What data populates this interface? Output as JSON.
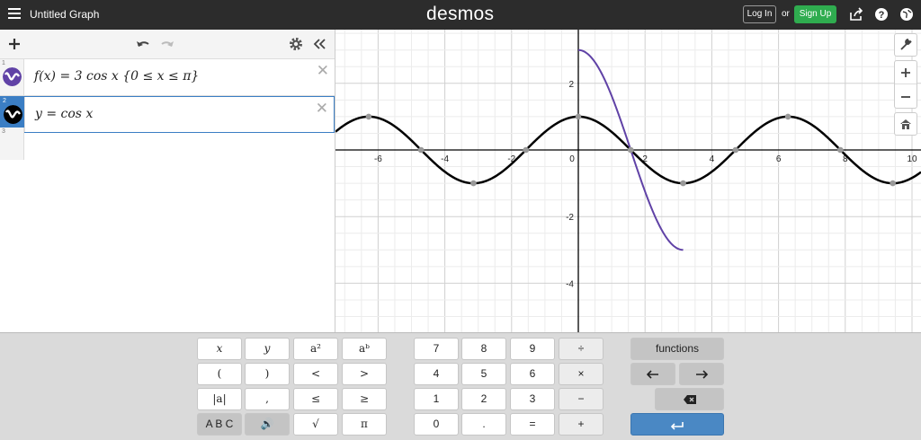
{
  "header": {
    "title": "Untitled Graph",
    "logo": "desmos",
    "login_label": "Log In",
    "or_label": "or",
    "signup_label": "Sign Up"
  },
  "sidebar": {
    "expressions": [
      {
        "number": "1",
        "latex": "f(x) = 3 cos x {0 ≤ x ≤ π}",
        "color": "#6042a6"
      },
      {
        "number": "2",
        "latex": "y = cos x",
        "color": "#000000"
      },
      {
        "number": "3",
        "latex": ""
      }
    ]
  },
  "graph": {
    "x_ticks": [
      "-6",
      "-4",
      "-2",
      "0",
      "2",
      "4",
      "6",
      "8",
      "10"
    ],
    "y_ticks": [
      "2",
      "-2",
      "-4"
    ]
  },
  "keypad": {
    "left": [
      [
        "x",
        "y",
        "a²",
        "aᵇ"
      ],
      [
        "(",
        ")",
        "<",
        ">"
      ],
      [
        "|a|",
        ",",
        "≤",
        "≥"
      ],
      [
        "A B C",
        "🔊",
        "√",
        "π"
      ]
    ],
    "middle": [
      [
        "7",
        "8",
        "9",
        "÷"
      ],
      [
        "4",
        "5",
        "6",
        "×"
      ],
      [
        "1",
        "2",
        "3",
        "−"
      ],
      [
        "0",
        ".",
        "=",
        "+"
      ]
    ],
    "functions_label": "functions"
  },
  "colors": {
    "accent": "#3b7ec4",
    "purple": "#6042a6",
    "signup": "#2fac4f"
  }
}
